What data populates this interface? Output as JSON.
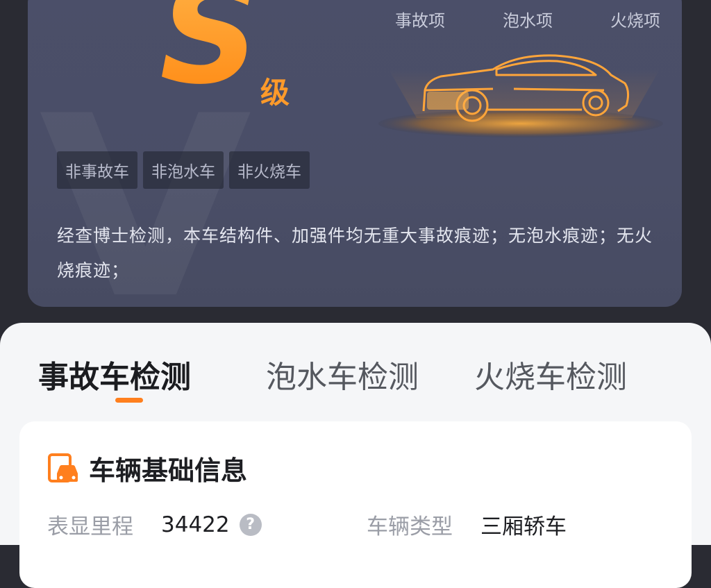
{
  "report": {
    "grade_letter": "S",
    "grade_suffix": "级",
    "check_items": [
      "事故项",
      "泡水项",
      "火烧项"
    ],
    "tags": [
      "非事故车",
      "非泡水车",
      "非火烧车"
    ],
    "description": "经查博士检测，本车结构件、加强件均无重大事故痕迹；无泡水痕迹；无火烧痕迹；"
  },
  "tabs": [
    {
      "label": "事故车检测",
      "active": true
    },
    {
      "label": "泡水车检测",
      "active": false
    },
    {
      "label": "火烧车检测",
      "active": false
    }
  ],
  "info": {
    "title": "车辆基础信息",
    "mileage_label": "表显里程",
    "mileage_value": "34422",
    "type_label": "车辆类型",
    "type_value": "三厢轿车"
  },
  "colors": {
    "accent": "#ff7f1e",
    "card_bg": "#4b4f69",
    "page_bg": "#2a2b33"
  }
}
